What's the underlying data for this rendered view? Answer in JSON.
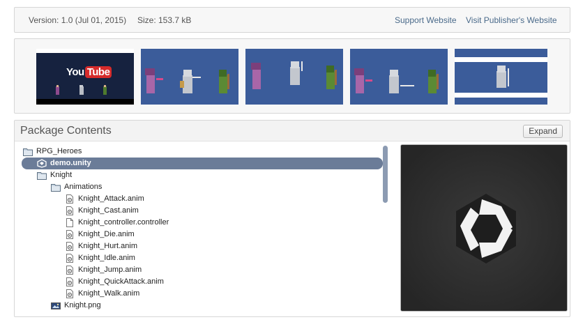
{
  "info": {
    "version": "Version: 1.0 (Jul 01, 2015)",
    "size": "Size: 153.7 kB",
    "support_link": "Support Website",
    "publisher_link": "Visit Publisher's Website"
  },
  "screenshots": {
    "video_logo_you": "You",
    "video_logo_tube": "Tube"
  },
  "package": {
    "title": "Package Contents",
    "expand_label": "Expand",
    "tree": [
      {
        "label": "RPG_Heroes",
        "icon": "folder-icon"
      },
      {
        "label": "demo.unity",
        "icon": "unity-scene-icon",
        "selected": true
      },
      {
        "label": "Knight",
        "icon": "folder-icon"
      },
      {
        "label": "Animations",
        "icon": "folder-icon"
      },
      {
        "label": "Knight_Attack.anim",
        "icon": "animation-file-icon"
      },
      {
        "label": "Knight_Cast.anim",
        "icon": "animation-file-icon"
      },
      {
        "label": "Knight_controller.controller",
        "icon": "file-icon"
      },
      {
        "label": "Knight_Die.anim",
        "icon": "animation-file-icon"
      },
      {
        "label": "Knight_Hurt.anim",
        "icon": "animation-file-icon"
      },
      {
        "label": "Knight_Idle.anim",
        "icon": "animation-file-icon"
      },
      {
        "label": "Knight_Jump.anim",
        "icon": "animation-file-icon"
      },
      {
        "label": "Knight_QuickAttack.anim",
        "icon": "animation-file-icon"
      },
      {
        "label": "Knight_Walk.anim",
        "icon": "animation-file-icon"
      },
      {
        "label": "Knight.png",
        "icon": "image-file-icon"
      }
    ],
    "preview_icon": "unity-logo-icon"
  }
}
